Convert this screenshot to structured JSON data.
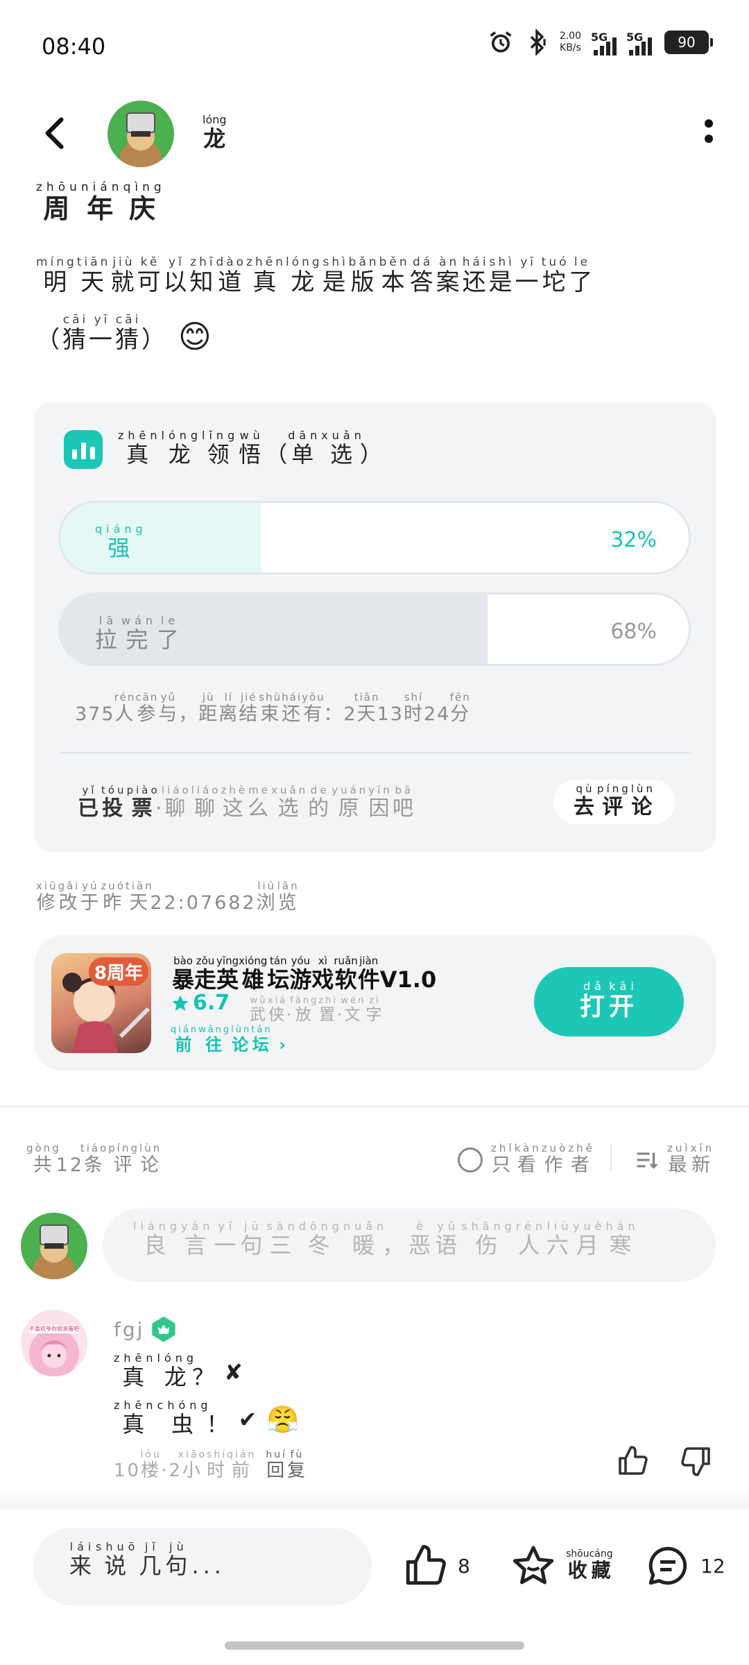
{
  "status_bar": {
    "time": "08:40",
    "net_speed_value": "2.00",
    "net_speed_unit": "KB/s",
    "sim1": "5G",
    "sim2": "5G",
    "battery": "90",
    "icons": [
      "alarm-icon",
      "bluetooth-icon",
      "signal-icon",
      "battery-icon"
    ]
  },
  "header": {
    "username": "龙",
    "username_pinyin": "lóng"
  },
  "post": {
    "tag": [
      [
        "周",
        "zhōu"
      ],
      [
        "年",
        "nián"
      ],
      [
        "庆",
        "qìng"
      ]
    ],
    "body_line1": [
      [
        "明",
        "míng"
      ],
      [
        "天",
        "tiān"
      ],
      [
        "就",
        "jiù"
      ],
      [
        "可",
        "kě"
      ],
      [
        "以",
        "yǐ"
      ],
      [
        "知",
        "zhī"
      ],
      [
        "道",
        "dào"
      ],
      [
        "真",
        "zhēn"
      ],
      [
        "龙",
        "lóng"
      ],
      [
        "是",
        "shì"
      ],
      [
        "版",
        "bǎn"
      ],
      [
        "本",
        "běn"
      ],
      [
        "答",
        "dá"
      ],
      [
        "案",
        "àn"
      ],
      [
        "还",
        "hái"
      ],
      [
        "是",
        "shì"
      ],
      [
        "一",
        "yī"
      ],
      [
        "坨",
        "tuó"
      ],
      [
        "了",
        "le"
      ]
    ],
    "body_line2": [
      [
        "（",
        ""
      ],
      [
        "猜",
        "cāi"
      ],
      [
        "一",
        "yī"
      ],
      [
        "猜",
        "cāi"
      ],
      [
        "）",
        ""
      ]
    ],
    "emoji": "😊"
  },
  "vote": {
    "title": [
      [
        "真",
        "zhēn"
      ],
      [
        "龙",
        "lóng"
      ],
      [
        "领",
        "lǐng"
      ],
      [
        "悟",
        "wù"
      ],
      [
        "（",
        ""
      ],
      [
        "单",
        "dān"
      ],
      [
        "选",
        "xuǎn"
      ],
      [
        "）",
        ""
      ]
    ],
    "options": [
      {
        "label": [
          [
            "强",
            "qiáng"
          ]
        ],
        "percent_text": "32%",
        "percent": 32
      },
      {
        "label": [
          [
            "拉",
            "lā"
          ],
          [
            "完",
            "wán"
          ],
          [
            "了",
            "le"
          ]
        ],
        "percent_text": "68%",
        "percent": 68
      }
    ],
    "meta": [
      [
        "375",
        ""
      ],
      [
        "人",
        "rén"
      ],
      [
        "参",
        "cān"
      ],
      [
        "与",
        "yǔ"
      ],
      [
        "，",
        ""
      ],
      [
        "距",
        "jù"
      ],
      [
        "离",
        "lí"
      ],
      [
        "结",
        "jié"
      ],
      [
        "束",
        "shù"
      ],
      [
        "还",
        "hái"
      ],
      [
        "有",
        "yǒu"
      ],
      [
        "：",
        ""
      ],
      [
        "2",
        ""
      ],
      [
        "天",
        "tiān"
      ],
      [
        "13",
        ""
      ],
      [
        "时",
        "shí"
      ],
      [
        "24",
        ""
      ],
      [
        "分",
        "fēn"
      ]
    ],
    "voted_strong": [
      [
        "已",
        "yǐ"
      ],
      [
        "投",
        "tóu"
      ],
      [
        "票",
        "piào"
      ]
    ],
    "voted_rest": [
      [
        "·",
        ""
      ],
      [
        "聊",
        "liáo"
      ],
      [
        "聊",
        "liáo"
      ],
      [
        "这",
        "zhè"
      ],
      [
        "么",
        "me"
      ],
      [
        "选",
        "xuǎn"
      ],
      [
        "的",
        "de"
      ],
      [
        "原",
        "yuán"
      ],
      [
        "因",
        "yīn"
      ],
      [
        "吧",
        "bā"
      ]
    ],
    "go_comment": [
      [
        "去",
        "qù"
      ],
      [
        "评",
        "píng"
      ],
      [
        "论",
        "lùn"
      ]
    ]
  },
  "edit_info": [
    [
      "修",
      "xiū"
    ],
    [
      "改",
      "gǎi"
    ],
    [
      "于",
      "yú"
    ],
    [
      "昨",
      "zuó"
    ],
    [
      "天",
      "tiān"
    ],
    [
      "22:07",
      ""
    ],
    [
      "682",
      ""
    ],
    [
      "浏",
      "liú"
    ],
    [
      "览",
      "lǎn"
    ]
  ],
  "app_card": {
    "badge": "8周年",
    "name": [
      [
        "暴",
        "bào"
      ],
      [
        "走",
        "zǒu"
      ],
      [
        "英",
        "yīng"
      ],
      [
        "雄",
        "xióng"
      ],
      [
        "坛",
        "tán"
      ],
      [
        "游",
        "yóu"
      ],
      [
        "戏",
        "xì"
      ],
      [
        "软",
        "ruǎn"
      ],
      [
        "件",
        "jiàn"
      ],
      [
        "V1.0",
        ""
      ]
    ],
    "rating": "6.7",
    "tags": [
      [
        "武",
        "wǔ"
      ],
      [
        "侠",
        "xiá"
      ],
      [
        "·",
        ""
      ],
      [
        "放",
        "fàng"
      ],
      [
        "置",
        "zhì"
      ],
      [
        "·",
        ""
      ],
      [
        "文",
        "wén"
      ],
      [
        "字",
        "zì"
      ]
    ],
    "forum_link": [
      [
        "前",
        "qián"
      ],
      [
        "往",
        "wǎng"
      ],
      [
        "论",
        "lùn"
      ],
      [
        "坛",
        "tán"
      ]
    ],
    "open_button": [
      [
        "打",
        "dǎ"
      ],
      [
        "开",
        "kāi"
      ]
    ],
    "accent_color": "#1dc7b6"
  },
  "comments_header": {
    "count": [
      [
        "共",
        "gòng"
      ],
      [
        "12",
        ""
      ],
      [
        "条",
        "tiáo"
      ],
      [
        "评",
        "píng"
      ],
      [
        "论",
        "lùn"
      ]
    ],
    "only_author": [
      [
        "只",
        "zhǐ"
      ],
      [
        "看",
        "kàn"
      ],
      [
        "作",
        "zuò"
      ],
      [
        "者",
        "zhě"
      ]
    ],
    "sort": [
      [
        "最",
        "zuì"
      ],
      [
        "新",
        "xīn"
      ]
    ]
  },
  "comment_input_placeholder": [
    [
      "良",
      "liáng"
    ],
    [
      "言",
      "yán"
    ],
    [
      "一",
      "yī"
    ],
    [
      "句",
      "jù"
    ],
    [
      "三",
      "sān"
    ],
    [
      "冬",
      "dōng"
    ],
    [
      "暖",
      "nuǎn"
    ],
    [
      "，",
      ""
    ],
    [
      "恶",
      "è"
    ],
    [
      "语",
      "yǔ"
    ],
    [
      "伤",
      "shāng"
    ],
    [
      "人",
      "rén"
    ],
    [
      "六",
      "liù"
    ],
    [
      "月",
      "yuè"
    ],
    [
      "寒",
      "hán"
    ]
  ],
  "comment": {
    "username": "fgj",
    "avatar_text": "不喜欢爷你就滚蛋吧",
    "line1": [
      [
        "真",
        "zhēn"
      ],
      [
        "龙",
        "lóng"
      ],
      [
        "？",
        ""
      ]
    ],
    "line1_mark": "✘",
    "line2": [
      [
        "真",
        "zhēn"
      ],
      [
        "虫",
        "chóng"
      ],
      [
        "！",
        ""
      ]
    ],
    "line2_mark": "✔",
    "line2_emoji": "😤",
    "meta": [
      [
        "10",
        ""
      ],
      [
        "楼",
        "lóu"
      ],
      [
        "·",
        ""
      ],
      [
        "2",
        ""
      ],
      [
        "小",
        "xiǎo"
      ],
      [
        "时",
        "shí"
      ],
      [
        "前",
        "qián"
      ]
    ],
    "reply": [
      [
        "回",
        "huí"
      ],
      [
        "复",
        "fù"
      ]
    ]
  },
  "bottom_bar": {
    "say": [
      [
        "来",
        "lái"
      ],
      [
        "说",
        "shuō"
      ],
      [
        "几",
        "jǐ"
      ],
      [
        "句",
        "jù"
      ],
      [
        "...",
        ""
      ]
    ],
    "likes": "8",
    "favorite": [
      [
        "收",
        "shōu"
      ],
      [
        "藏",
        "cáng"
      ]
    ],
    "comments": "12"
  }
}
